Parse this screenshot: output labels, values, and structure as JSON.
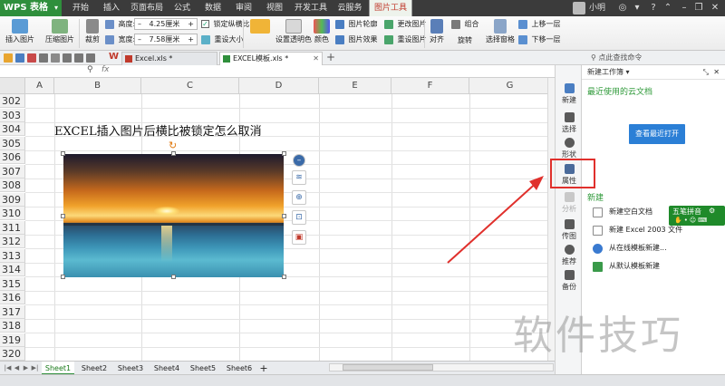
{
  "app": {
    "logo_label": "WPS 表格",
    "menu_tabs": [
      "开始",
      "插入",
      "页面布局",
      "公式",
      "数据",
      "审阅",
      "视图",
      "开发工具",
      "云服务",
      "图片工具"
    ],
    "active_menu": "图片工具",
    "user_name": "小明"
  },
  "ribbon": {
    "insert_picture": "插入图片",
    "compress_picture": "压缩图片",
    "crop": "裁剪",
    "rotate": "旋转",
    "height_label": "高度:",
    "height_value": "4.25厘米",
    "width_label": "宽度:",
    "width_value": "7.58厘米",
    "lock_ratio": "锁定纵横比",
    "reset_size": "重设大小",
    "set_transparent": "设置透明色",
    "color": "颜色",
    "picture_outline": "图片轮廓",
    "picture_effect": "图片效果",
    "change_picture": "更改图片",
    "reset_picture": "重设图片",
    "align": "对齐",
    "rotate2": "旋转",
    "group": "组合",
    "selection_pane": "选择窗格",
    "bring_forward": "上移一层",
    "send_backward": "下移一层"
  },
  "doc_tabs": [
    {
      "label": "Excel.xls *",
      "active": false
    },
    {
      "label": "EXCEL模板.xls *",
      "active": true
    }
  ],
  "formula_bar": {
    "fx_label": "fx"
  },
  "grid": {
    "columns": [
      "A",
      "B",
      "C",
      "D",
      "E",
      "F",
      "G"
    ],
    "rows": [
      "302",
      "303",
      "304",
      "305",
      "306",
      "307",
      "308",
      "309",
      "310",
      "311",
      "312",
      "313",
      "314",
      "315",
      "316",
      "317",
      "318",
      "319",
      "320"
    ],
    "cell_text": "EXCEL插入图片后横比被锁定怎么取消"
  },
  "sheets": [
    "Sheet1",
    "Sheet2",
    "Sheet3",
    "Sheet4",
    "Sheet5",
    "Sheet6"
  ],
  "active_sheet": "Sheet1",
  "sidebar": {
    "items": [
      "新建",
      "选择",
      "形状",
      "属性",
      "分析",
      "传图",
      "推荐",
      "备份"
    ]
  },
  "taskpane": {
    "title": "新建工作簿",
    "search_label": "点此查找命令",
    "recent_cloud": "最近使用的云文档",
    "open_recent_button": "查看最近打开",
    "new_section": "新建",
    "items": [
      "新建空白文档",
      "新建 Excel 2003 文件",
      "从在线模板新建...",
      "从默认模板新建"
    ]
  },
  "ime": {
    "label": "五笔拼音"
  },
  "watermark": "软件技巧",
  "colors": {
    "brand_green": "#2f8f3c",
    "highlight_red": "#e0302c",
    "accent_blue": "#2b7fd6"
  }
}
